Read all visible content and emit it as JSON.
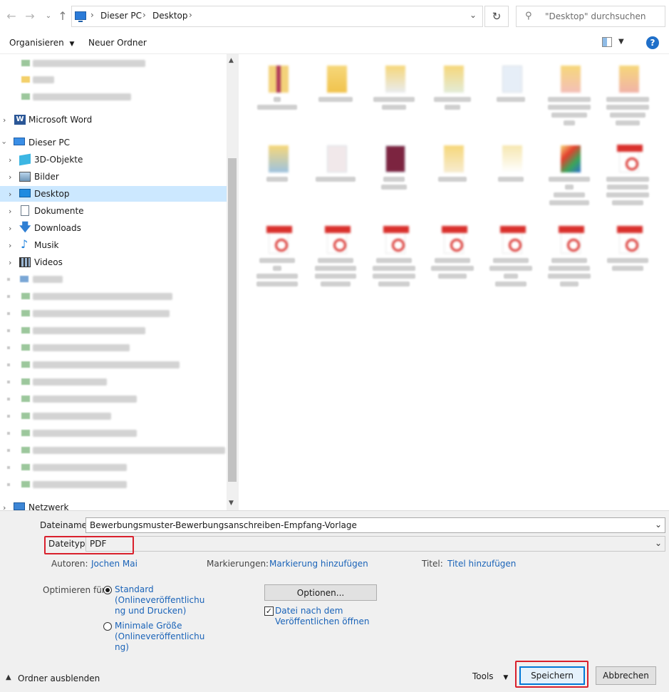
{
  "address": {
    "path": [
      "Dieser PC",
      "Desktop"
    ],
    "search_placeholder": "\"Desktop\" durchsuchen"
  },
  "toolbar": {
    "organize": "Organisieren",
    "new_folder": "Neuer Ordner",
    "help": "?"
  },
  "nav": {
    "microsoft_word": "Microsoft Word",
    "this_pc": "Dieser PC",
    "items": [
      "3D-Objekte",
      "Bilder",
      "Desktop",
      "Dokumente",
      "Downloads",
      "Musik",
      "Videos"
    ],
    "network": "Netzwerk"
  },
  "form": {
    "filename_label": "Dateiname:",
    "filename_value": "Bewerbungsmuster-Bewerbungsanschreiben-Empfang-Vorlage",
    "filetype_label": "Dateityp:",
    "filetype_value": "PDF",
    "authors_label": "Autoren:",
    "authors_value": "Jochen Mai",
    "tags_label": "Markierungen:",
    "tags_value": "Markierung hinzufügen",
    "title_label": "Titel:",
    "title_value": "Titel hinzufügen",
    "optimize_label": "Optimieren für:",
    "opt_standard": [
      "Standard",
      "(Onlineveröffentlichu",
      "ng und Drucken)"
    ],
    "opt_minimal": [
      "Minimale Größe",
      "(Onlineveröffentlichu",
      "ng)"
    ],
    "options_button": "Optionen...",
    "open_after": [
      "Datei nach dem",
      "Veröffentlichen öffnen"
    ],
    "hide_folders": "Ordner ausblenden",
    "tools": "Tools",
    "save": "Speichern",
    "cancel": "Abbrechen"
  }
}
